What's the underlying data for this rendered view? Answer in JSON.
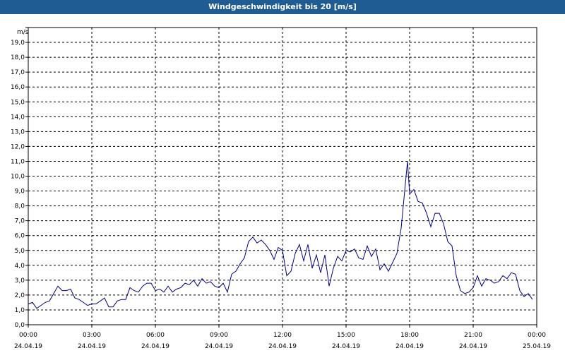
{
  "window": {
    "title": "Windgeschwindigkeit bis 20 [m/s]"
  },
  "chart_data": {
    "type": "line",
    "title": "Windgeschwindigkeit bis 20 [m/s]",
    "ylabel": "m/s",
    "xlabel": "",
    "ylim": [
      0,
      20
    ],
    "xlim_hours": [
      0,
      24
    ],
    "yticks": [
      "0,0",
      "1,0",
      "2,0",
      "3,0",
      "4,0",
      "5,0",
      "6,0",
      "7,0",
      "8,0",
      "9,0",
      "10,0",
      "11,0",
      "12,0",
      "13,0",
      "14,0",
      "15,0",
      "16,0",
      "17,0",
      "18,0",
      "19,0"
    ],
    "xticks": [
      {
        "time": "00:00",
        "date": "24.04.19"
      },
      {
        "time": "03:00",
        "date": "24.04.19"
      },
      {
        "time": "06:00",
        "date": "24.04.19"
      },
      {
        "time": "09:00",
        "date": "24.04.19"
      },
      {
        "time": "12:00",
        "date": "24.04.19"
      },
      {
        "time": "15:00",
        "date": "24.04.19"
      },
      {
        "time": "18:00",
        "date": "24.04.19"
      },
      {
        "time": "21:00",
        "date": "24.04.19"
      },
      {
        "time": "00:00",
        "date": "25.04.19"
      }
    ],
    "grid": true,
    "line_color": "#00008b",
    "series": [
      {
        "x": [
          0.0,
          0.2,
          0.4,
          0.6,
          0.8,
          1.0,
          1.2,
          1.4,
          1.6,
          1.8,
          2.0,
          2.2,
          2.4,
          2.6,
          2.8,
          3.0,
          3.2,
          3.4,
          3.6,
          3.8,
          4.0,
          4.2,
          4.4,
          4.6,
          4.8,
          5.0,
          5.2,
          5.4,
          5.6,
          5.8,
          6.0,
          6.2,
          6.4,
          6.6,
          6.8,
          7.0,
          7.2,
          7.4,
          7.6,
          7.8,
          8.0,
          8.2,
          8.4,
          8.6,
          8.8,
          9.0,
          9.2,
          9.4,
          9.6,
          9.8,
          10.0,
          10.2,
          10.4,
          10.6,
          10.8,
          11.0,
          11.2,
          11.4,
          11.6,
          11.8,
          12.0,
          12.2,
          12.4,
          12.6,
          12.8,
          13.0,
          13.2,
          13.4,
          13.6,
          13.8,
          14.0,
          14.2,
          14.4,
          14.6,
          14.8,
          15.0,
          15.2,
          15.4,
          15.6,
          15.8,
          16.0,
          16.2,
          16.4,
          16.6,
          16.8,
          17.0,
          17.2,
          17.4,
          17.6,
          17.8,
          17.9,
          18.0,
          18.2,
          18.4,
          18.6,
          18.8,
          19.0,
          19.2,
          19.4,
          19.6,
          19.8,
          20.0,
          20.2,
          20.4,
          20.6,
          20.8,
          21.0,
          21.2,
          21.4,
          21.6,
          21.8,
          22.0,
          22.2,
          22.4,
          22.6,
          22.8,
          23.0,
          23.2,
          23.4,
          23.6,
          23.8
        ],
        "values": [
          1.4,
          1.5,
          1.1,
          1.3,
          1.5,
          1.6,
          2.1,
          2.6,
          2.3,
          2.3,
          2.4,
          1.8,
          1.7,
          1.5,
          1.3,
          1.4,
          1.4,
          1.6,
          1.8,
          1.2,
          1.2,
          1.6,
          1.7,
          1.7,
          2.5,
          2.3,
          2.2,
          2.6,
          2.8,
          2.8,
          2.3,
          2.4,
          2.2,
          2.6,
          2.2,
          2.4,
          2.5,
          2.8,
          2.7,
          3.0,
          2.6,
          3.1,
          2.8,
          2.9,
          2.6,
          2.5,
          2.8,
          2.2,
          3.4,
          3.6,
          4.1,
          4.5,
          5.6,
          5.9,
          5.5,
          5.7,
          5.4,
          5.0,
          4.4,
          5.2,
          5.0,
          3.3,
          3.6,
          4.8,
          5.4,
          4.3,
          5.4,
          3.8,
          4.7,
          3.5,
          4.7,
          2.6,
          3.8,
          4.6,
          4.3,
          5.0,
          4.9,
          5.1,
          4.5,
          4.4,
          5.3,
          4.6,
          5.1,
          3.7,
          4.1,
          3.6,
          4.2,
          4.8,
          6.5,
          9.5,
          11.0,
          8.8,
          9.1,
          8.3,
          8.2,
          7.5,
          6.6,
          7.5,
          7.5,
          6.8,
          5.6,
          5.3,
          3.3,
          2.3,
          2.1,
          2.2,
          2.5,
          3.3,
          2.6,
          3.1,
          3.0,
          2.8,
          2.9,
          3.3,
          3.1,
          3.5,
          3.4,
          2.3,
          1.9,
          2.1,
          1.7
        ]
      }
    ]
  }
}
